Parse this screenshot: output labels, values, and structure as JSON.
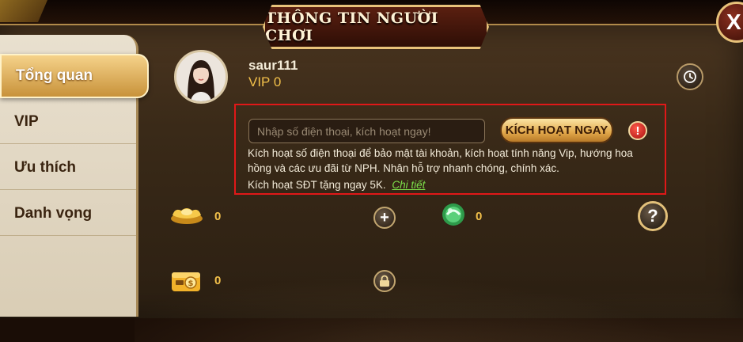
{
  "title": "THÔNG TIN NGƯỜI CHƠI",
  "close_label": "X",
  "sidebar": {
    "items": [
      {
        "label": "Tổng quan",
        "active": true
      },
      {
        "label": "VIP",
        "active": false
      },
      {
        "label": "Ưu thích",
        "active": false
      },
      {
        "label": "Danh vọng",
        "active": false
      }
    ]
  },
  "profile": {
    "username": "saur111",
    "vip": "VIP 0"
  },
  "activation": {
    "placeholder": "Nhập số điện thoại, kích hoạt ngay!",
    "button_label": "KÍCH HOẠT NGAY",
    "warning_label": "!",
    "description": "Kích hoạt số điện thoại để bảo mật tài khoản, kích hoạt tính năng Vip, hướng hoa hồng và các ưu đãi từ NPH. Nhân hỗ trợ nhanh chóng, chính xác.",
    "gift_text": "Kích hoạt SĐT tặng ngay 5K.",
    "detail_link": "Chi tiết"
  },
  "currencies": {
    "gold": "0",
    "gem": "0",
    "wallet": "0"
  },
  "buttons": {
    "add": "+",
    "help": "?"
  },
  "colors": {
    "accent_gold": "#f2c04a",
    "highlight_border": "#e01818",
    "link_green": "#7de04a"
  },
  "icons": [
    "history-icon",
    "gold-ingot-icon",
    "gem-icon",
    "wallet-icon",
    "lock-icon",
    "plus-icon",
    "help-icon",
    "warning-icon",
    "close-icon"
  ]
}
